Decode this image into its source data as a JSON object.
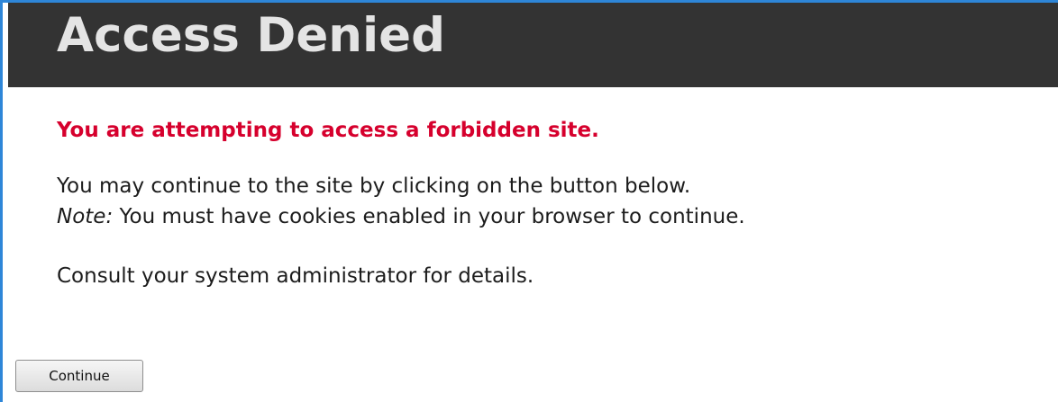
{
  "header": {
    "title": "Access Denied"
  },
  "content": {
    "warning": "You are attempting to access a forbidden site.",
    "line1": "You may continue to the site by clicking on the button below.",
    "note_label": "Note:",
    "note_text": " You must have cookies enabled in your browser to continue.",
    "consult": "Consult your system administrator for details."
  },
  "actions": {
    "continue_label": "Continue"
  },
  "colors": {
    "header_bg": "#333333",
    "title_text": "#e4e4e4",
    "warning_text": "#d6002d",
    "window_border": "#2e86d8"
  }
}
